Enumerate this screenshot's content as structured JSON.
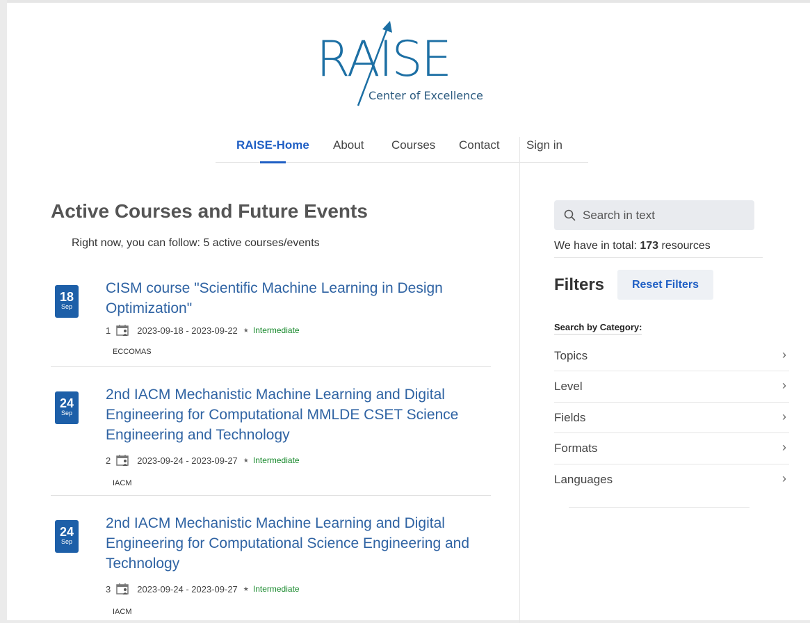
{
  "logo": {
    "text": "RAISE",
    "subtitle": "Center of Excellence",
    "color": "#1c6fa4"
  },
  "nav": {
    "items": [
      {
        "label": "RAISE-Home",
        "active": true
      },
      {
        "label": "About"
      },
      {
        "label": "Courses"
      },
      {
        "label": "Contact"
      },
      {
        "label": "Sign in"
      }
    ]
  },
  "main": {
    "heading": "Active Courses and Future Events",
    "subtext": "Right now, you can follow: 5 active courses/events",
    "courses": [
      {
        "day": "18",
        "month": "Sep",
        "title": "CISM course \"Scientific Machine Learning in Design Optimization\"",
        "number": "1",
        "dates": "2023-09-18 - 2023-09-22",
        "level": "Intermediate",
        "org": "ECCOMAS"
      },
      {
        "day": "24",
        "month": "Sep",
        "title": "2nd IACM Mechanistic Machine Learning and Digital Engineering for Computational MMLDE CSET Science Engineering and Technology",
        "number": "2",
        "dates": "2023-09-24 - 2023-09-27",
        "level": "Intermediate",
        "org": "IACM"
      },
      {
        "day": "24",
        "month": "Sep",
        "title": "2nd IACM Mechanistic Machine Learning and Digital Engineering for Computational Science Engineering and Technology",
        "number": "3",
        "dates": "2023-09-24 - 2023-09-27",
        "level": "Intermediate",
        "org": "IACM"
      }
    ]
  },
  "sidebar": {
    "search_placeholder": "Search in text",
    "total_prefix": "We have in total: ",
    "total_count": "173",
    "total_suffix": " resources",
    "filters_heading": "Filters",
    "reset_label": "Reset Filters",
    "category_label": "Search by Category:",
    "categories": [
      "Topics",
      "Level",
      "Fields",
      "Formats",
      "Languages"
    ]
  },
  "colors": {
    "accent": "#1f5fc4",
    "badge": "#1d5fa8",
    "level": "#1a8a2e"
  }
}
